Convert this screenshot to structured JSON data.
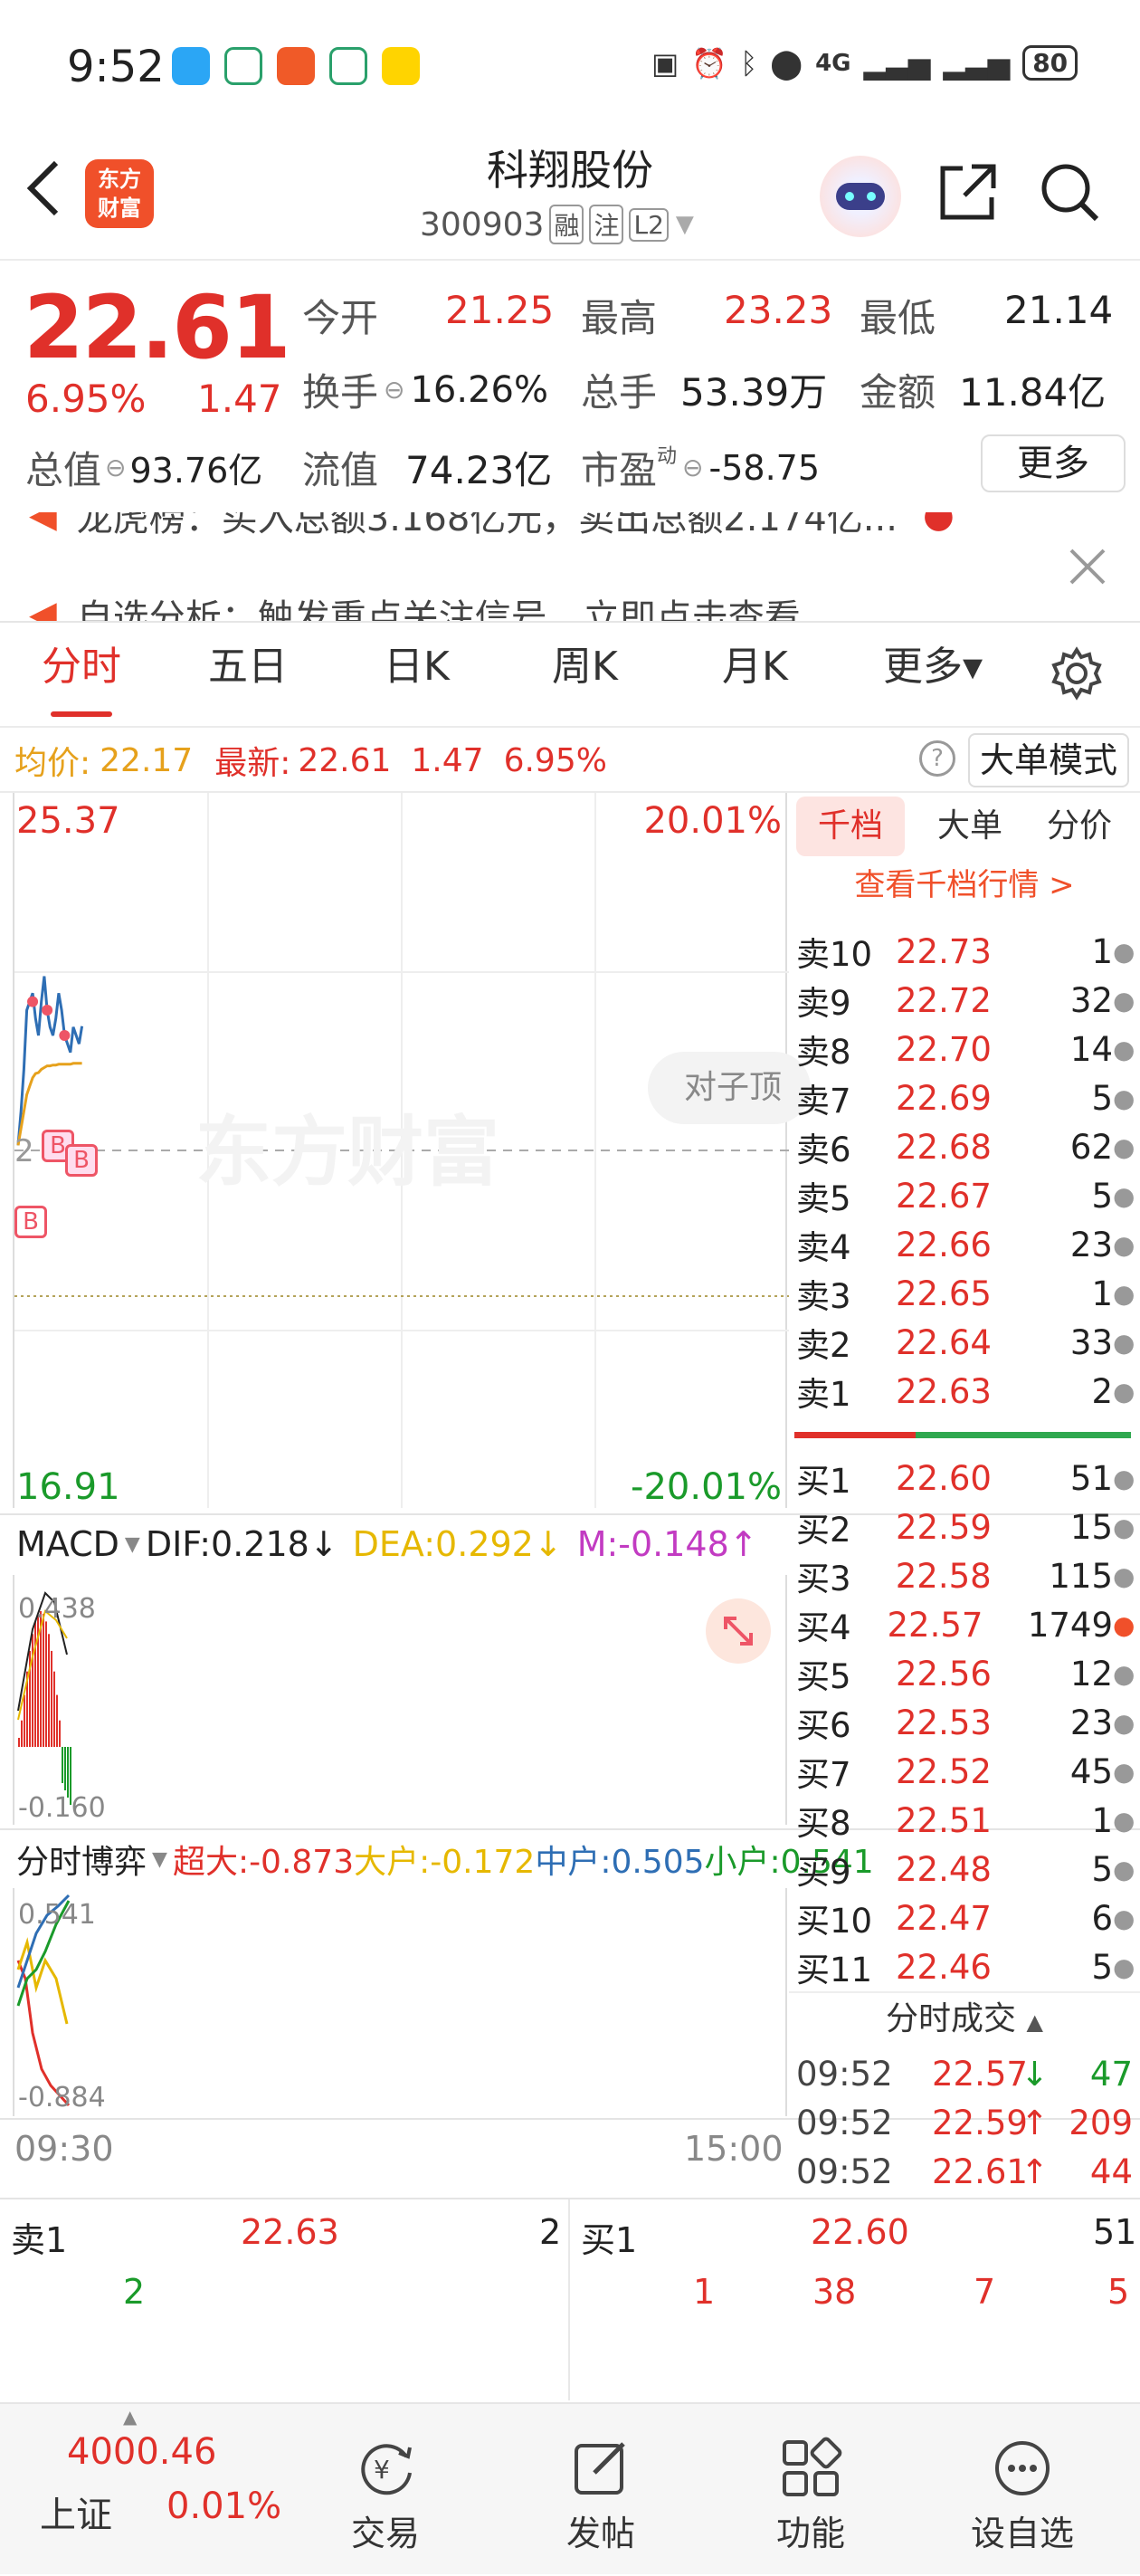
{
  "status_bar": {
    "time": "9:52",
    "signal": "4G",
    "battery": "80"
  },
  "header": {
    "stock_name": "科翔股份",
    "stock_code": "300903",
    "tag_rong": "融",
    "tag_zhu": "注",
    "tag_level": "L2",
    "logo_line1": "东方",
    "logo_line2": "财富"
  },
  "quote": {
    "price": "22.61",
    "change_pct": "6.95%",
    "change": "1.47",
    "open_label": "今开",
    "open": "21.25",
    "high_label": "最高",
    "high": "23.23",
    "low_label": "最低",
    "low": "21.14",
    "turnover_label": "换手",
    "turnover": "16.26%",
    "volume_label": "总手",
    "volume": "53.39万",
    "amount_label": "金额",
    "amount": "11.84亿",
    "mcap_label": "总值",
    "mcap": "93.76亿",
    "float_label": "流值",
    "float_cap": "74.23亿",
    "pe_label": "市盈",
    "pe_sup": "动",
    "pe": "-58.75",
    "more_button": "更多"
  },
  "news": {
    "line1": "龙虎榜：买入总额3.168亿元，卖出总额2.174亿...",
    "line2": "自选分析：触发重点关注信号，立即点击查看"
  },
  "tabs": [
    {
      "label": "分时",
      "active": true
    },
    {
      "label": "五日"
    },
    {
      "label": "日K"
    },
    {
      "label": "周K"
    },
    {
      "label": "月K"
    },
    {
      "label": "更多▾"
    }
  ],
  "info_bar": {
    "avg_label": "均价:",
    "avg": "22.17",
    "latest_label": "最新:",
    "latest": "22.61",
    "change": "1.47",
    "change_pct": "6.95%",
    "bigorder_button": "大单模式"
  },
  "chart": {
    "y_top": "25.37",
    "y_top_pct": "20.01%",
    "y_bottom": "16.91",
    "y_bottom_pct": "-20.01%",
    "pair_button": "对子顶",
    "watermark": "东方财富",
    "time_start": "09:30",
    "time_end": "15:00",
    "mid_label": "2"
  },
  "chart_data": {
    "type": "line",
    "x": [
      "09:30",
      "09:31",
      "09:32",
      "09:33",
      "09:34",
      "09:35",
      "09:36",
      "09:37",
      "09:38",
      "09:39",
      "09:40",
      "09:41",
      "09:42",
      "09:43",
      "09:44",
      "09:45",
      "09:46",
      "09:47",
      "09:48",
      "09:49",
      "09:50",
      "09:51",
      "09:52"
    ],
    "series": [
      {
        "name": "最新",
        "values": [
          21.2,
          21.6,
          22.1,
          22.8,
          22.9,
          23.0,
          22.7,
          22.5,
          22.9,
          23.2,
          22.8,
          22.6,
          22.5,
          22.7,
          23.0,
          22.8,
          22.5,
          22.4,
          22.3,
          22.6,
          22.5,
          22.4,
          22.61
        ]
      },
      {
        "name": "均价",
        "values": [
          21.2,
          21.4,
          21.6,
          21.8,
          21.9,
          22.0,
          22.05,
          22.06,
          22.1,
          22.12,
          22.14,
          22.14,
          22.15,
          22.15,
          22.16,
          22.16,
          22.16,
          22.16,
          22.16,
          22.17,
          22.17,
          22.17,
          22.17
        ]
      }
    ],
    "ylim": [
      16.91,
      25.37
    ]
  },
  "macd": {
    "label": "MACD",
    "dif": "DIF:0.218",
    "dea": "DEA:0.292",
    "m": "M:-0.148",
    "top": "0.438",
    "bottom": "-0.160"
  },
  "flow": {
    "label": "分时博弈",
    "chaoda": "超大:-0.873",
    "dahu": "大户:-0.172",
    "zhonghu": "中户:0.505",
    "xiaohu": "小户:0.541",
    "top": "0.541",
    "bottom": "-0.884"
  },
  "book_tabs": [
    {
      "label": "千档",
      "active": true
    },
    {
      "label": "大单"
    },
    {
      "label": "分价"
    }
  ],
  "book_link": "查看千档行情 >",
  "asks": [
    {
      "label": "卖10",
      "price": "22.73",
      "vol": "1"
    },
    {
      "label": "卖9",
      "price": "22.72",
      "vol": "32"
    },
    {
      "label": "卖8",
      "price": "22.70",
      "vol": "14"
    },
    {
      "label": "卖7",
      "price": "22.69",
      "vol": "5"
    },
    {
      "label": "卖6",
      "price": "22.68",
      "vol": "62"
    },
    {
      "label": "卖5",
      "price": "22.67",
      "vol": "5"
    },
    {
      "label": "卖4",
      "price": "22.66",
      "vol": "23"
    },
    {
      "label": "卖3",
      "price": "22.65",
      "vol": "1"
    },
    {
      "label": "卖2",
      "price": "22.64",
      "vol": "33"
    },
    {
      "label": "卖1",
      "price": "22.63",
      "vol": "2"
    }
  ],
  "bids": [
    {
      "label": "买1",
      "price": "22.60",
      "vol": "51"
    },
    {
      "label": "买2",
      "price": "22.59",
      "vol": "15"
    },
    {
      "label": "买3",
      "price": "22.58",
      "vol": "115"
    },
    {
      "label": "买4",
      "price": "22.57",
      "vol": "1749"
    },
    {
      "label": "买5",
      "price": "22.56",
      "vol": "12"
    },
    {
      "label": "买6",
      "price": "22.53",
      "vol": "23"
    },
    {
      "label": "买7",
      "price": "22.52",
      "vol": "45"
    },
    {
      "label": "买8",
      "price": "22.51",
      "vol": "1"
    },
    {
      "label": "买9",
      "price": "22.48",
      "vol": "5"
    },
    {
      "label": "买10",
      "price": "22.47",
      "vol": "6"
    },
    {
      "label": "买11",
      "price": "22.46",
      "vol": "5"
    }
  ],
  "trades_title": "分时成交",
  "trades": [
    {
      "time": "09:52",
      "price": "22.57",
      "dir": "↓",
      "vol": "47"
    },
    {
      "time": "09:52",
      "price": "22.59",
      "dir": "↑",
      "vol": "209"
    },
    {
      "time": "09:52",
      "price": "22.61",
      "dir": "↑",
      "vol": "44"
    }
  ],
  "bottom_quote": {
    "sell_label": "卖1",
    "sell_price": "22.63",
    "sell_vol": "2",
    "sell_detail": "2",
    "buy_label": "买1",
    "buy_price": "22.60",
    "buy_vol": "51",
    "buy_d1": "1",
    "buy_d2": "38",
    "buy_d3": "7",
    "buy_d4": "5"
  },
  "bottom_nav": {
    "index_value": "4000.46",
    "index_name": "上证",
    "index_pct": "0.01%",
    "trade": "交易",
    "post": "发帖",
    "func": "功能",
    "settings": "设自选"
  }
}
